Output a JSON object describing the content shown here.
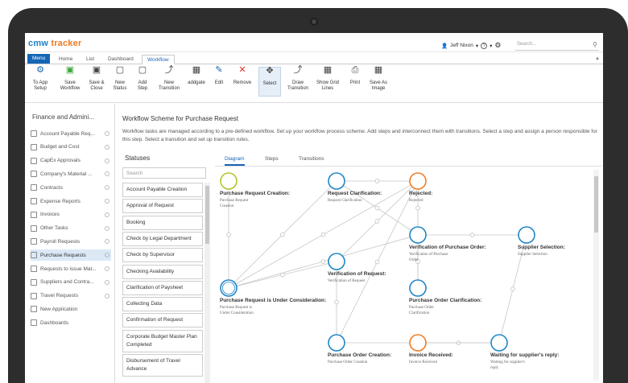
{
  "app": {
    "logo_a": "cmw",
    "logo_b": "tracker"
  },
  "user": {
    "name": "Jeff Nixon",
    "help": "?"
  },
  "search": {
    "placeholder": "Search..."
  },
  "tabs": [
    "Menu",
    "Home",
    "List",
    "Dashboard",
    "Workflow"
  ],
  "ribbon": [
    {
      "label": "To App Setup",
      "icon": "app-setup-icon"
    },
    {
      "label": "Save Workflow",
      "icon": "save-icon"
    },
    {
      "label": "Save & Close",
      "icon": "save-close-icon"
    },
    {
      "label": "New Status",
      "icon": "new-status-icon"
    },
    {
      "label": "Add Step",
      "icon": "add-step-icon"
    },
    {
      "label": "New Transition",
      "icon": "new-transition-icon"
    },
    {
      "label": "addgate",
      "icon": "add-gate-icon"
    },
    {
      "label": "Edit",
      "icon": "edit-icon"
    },
    {
      "label": "Remove",
      "icon": "remove-icon"
    },
    {
      "label": "Select",
      "icon": "select-icon"
    },
    {
      "label": "Draw Transition",
      "icon": "draw-transition-icon"
    },
    {
      "label": "Show Grid Lines",
      "icon": "grid-icon"
    },
    {
      "label": "Print",
      "icon": "print-icon"
    },
    {
      "label": "Save As Image",
      "icon": "save-image-icon"
    }
  ],
  "sidebar": {
    "title": "Finance and Admini...",
    "items": [
      "Account Payable Req...",
      "Budget and Cost",
      "CapEx Approvals",
      "Company's Material ...",
      "Contracts",
      "Expense Reports",
      "Invoices",
      "Other Tasks",
      "Payroll Requests",
      "Purchase Requests",
      "Requests to issue Mat...",
      "Suppliers and Contra...",
      "Travel Requests",
      "New Application",
      "Dashboards"
    ],
    "active_index": 9
  },
  "main": {
    "title": "Workflow Scheme for Purchase Request",
    "description": "Workflow tasks are managed according to a pre-defined workflow. Set up your workflow process scheme. Add steps and interconnect them with transitions. Select a step and assign a person responsible for this step. Select a transition and set up transition rules."
  },
  "statuses": {
    "title": "Statuses",
    "search_placeholder": "Search",
    "items": [
      "Account Payable Creation",
      "Approval of Request",
      "Booking",
      "Check by Legal Department",
      "Check by Supervisor",
      "Checking Availability",
      "Clarification of Paysheet",
      "Collecting Data",
      "Confirmation of Request",
      "Corporate Budget Master Plan Completed",
      "Disbursement of Travel Advance"
    ]
  },
  "diagram_tabs": [
    "Diagram",
    "Steps",
    "Transitions"
  ],
  "diagram": {
    "colors": {
      "start": "#b5c42a",
      "step": "#1f86c8",
      "reject": "#f07b22",
      "line": "#c6c6c6"
    },
    "nodes": [
      {
        "id": "prc",
        "title": "Purchase Request Creation:",
        "sub": "Purchase Request Creation",
        "kind": "start"
      },
      {
        "id": "rcl",
        "title": "Request Clarification:",
        "sub": "Request Clarification",
        "kind": "step"
      },
      {
        "id": "rej",
        "title": "Rejected:",
        "sub": "Rejected",
        "kind": "reject"
      },
      {
        "id": "vpo",
        "title": "Verification of Purchase Order:",
        "sub": "Verification of Purchase Order",
        "kind": "step"
      },
      {
        "id": "ssl",
        "title": "Supplier Selection:",
        "sub": "Supplier Selection",
        "kind": "step"
      },
      {
        "id": "vor",
        "title": "Verification of Request:",
        "sub": "Verification of Request",
        "kind": "step"
      },
      {
        "id": "puc",
        "title": "Purchase Request is Under Consideration:",
        "sub": "Purchase Request is Under Consideration",
        "kind": "step"
      },
      {
        "id": "poc",
        "title": "Purchase Order Clarification:",
        "sub": "Purchase Order Clarification",
        "kind": "step"
      },
      {
        "id": "pcr",
        "title": "Purchase Order Creation:",
        "sub": "Purchase Order Creation",
        "kind": "step"
      },
      {
        "id": "inv",
        "title": "Invoice Received:",
        "sub": "Invoice Received",
        "kind": "reject"
      },
      {
        "id": "wsr",
        "title": "Waiting for supplier's reply:",
        "sub": "Waiting for supplier's reply",
        "kind": "step"
      }
    ]
  }
}
